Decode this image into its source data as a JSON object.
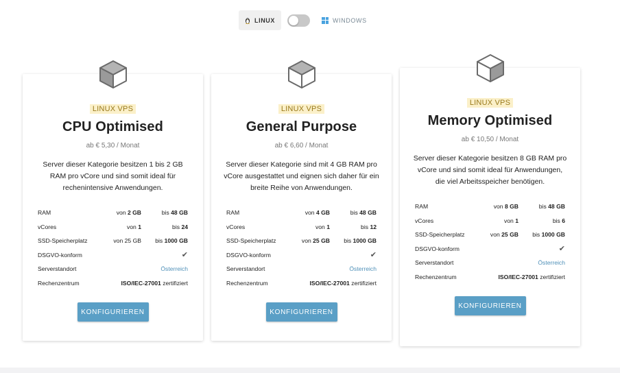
{
  "os_switch": {
    "linux_label": "LINUX",
    "windows_label": "WINDOWS",
    "selected": "LINUX"
  },
  "spec_labels": {
    "ram": "RAM",
    "vcores": "vCores",
    "ssd": "SSD-Speicherplatz",
    "dsgvo": "DSGVO-konform",
    "location": "Serverstandort",
    "datacenter": "Rechenzentrum"
  },
  "cards": [
    {
      "badge": "LINUX VPS",
      "title": "CPU Optimised",
      "price": "ab € 5,30 / Monat",
      "description": "Server dieser Kategorie besitzen 1 bis 2 GB RAM pro vCore und sind somit ideal für rechenintensive Anwendungen.",
      "ram_from_prefix": "von",
      "ram_from": "2 GB",
      "ram_to_prefix": "bis",
      "ram_to": "48 GB",
      "vcores_from_prefix": "von",
      "vcores_from": "1",
      "vcores_to_prefix": "bis",
      "vcores_to": "24",
      "ssd_from_prefix": "von",
      "ssd_from": "25 GB",
      "ssd_to_prefix": "bis",
      "ssd_to": "1000 GB",
      "dsgvo": "✔",
      "location": "Österreich",
      "datacenter_strong": "ISO/IEC-27001",
      "datacenter_rest": "zertifiziert",
      "button": "KONFIGURIEREN"
    },
    {
      "badge": "LINUX VPS",
      "title": "General Purpose",
      "price": "ab € 6,60 / Monat",
      "description": "Server dieser Kategorie sind mit 4 GB RAM pro vCore ausgestattet und eignen sich daher für ein breite Reihe von Anwendungen.",
      "ram_from_prefix": "von",
      "ram_from": "4 GB",
      "ram_to_prefix": "bis",
      "ram_to": "48 GB",
      "vcores_from_prefix": "von",
      "vcores_from": "1",
      "vcores_to_prefix": "bis",
      "vcores_to": "12",
      "ssd_from_prefix": "von",
      "ssd_from": "25 GB",
      "ssd_to_prefix": "bis",
      "ssd_to": "1000 GB",
      "dsgvo": "✔",
      "location": "Österreich",
      "datacenter_strong": "ISO/IEC-27001",
      "datacenter_rest": "zertifiziert",
      "button": "KONFIGURIEREN"
    },
    {
      "badge": "LINUX VPS",
      "title": "Memory Optimised",
      "price": "ab € 10,50 / Monat",
      "description": "Server dieser Kategorie besitzen 8 GB RAM pro vCore und sind somit ideal für Anwendungen, die viel Arbeitsspeicher benötigen.",
      "ram_from_prefix": "von",
      "ram_from": "8 GB",
      "ram_to_prefix": "bis",
      "ram_to": "48 GB",
      "vcores_from_prefix": "von",
      "vcores_from": "1",
      "vcores_to_prefix": "bis",
      "vcores_to": "6",
      "ssd_from_prefix": "von",
      "ssd_from": "25 GB",
      "ssd_to_prefix": "bis",
      "ssd_to": "1000 GB",
      "dsgvo": "✔",
      "location": "Österreich",
      "datacenter_strong": "ISO/IEC-27001",
      "datacenter_rest": "zertifiziert",
      "button": "KONFIGURIEREN"
    }
  ],
  "colors": {
    "badge_bg": "#fbf0c9",
    "badge_text": "#9a7a1c",
    "button_bg": "#5a9fc6",
    "link": "#4f90b8",
    "windows_icon": "#4aa3df"
  }
}
